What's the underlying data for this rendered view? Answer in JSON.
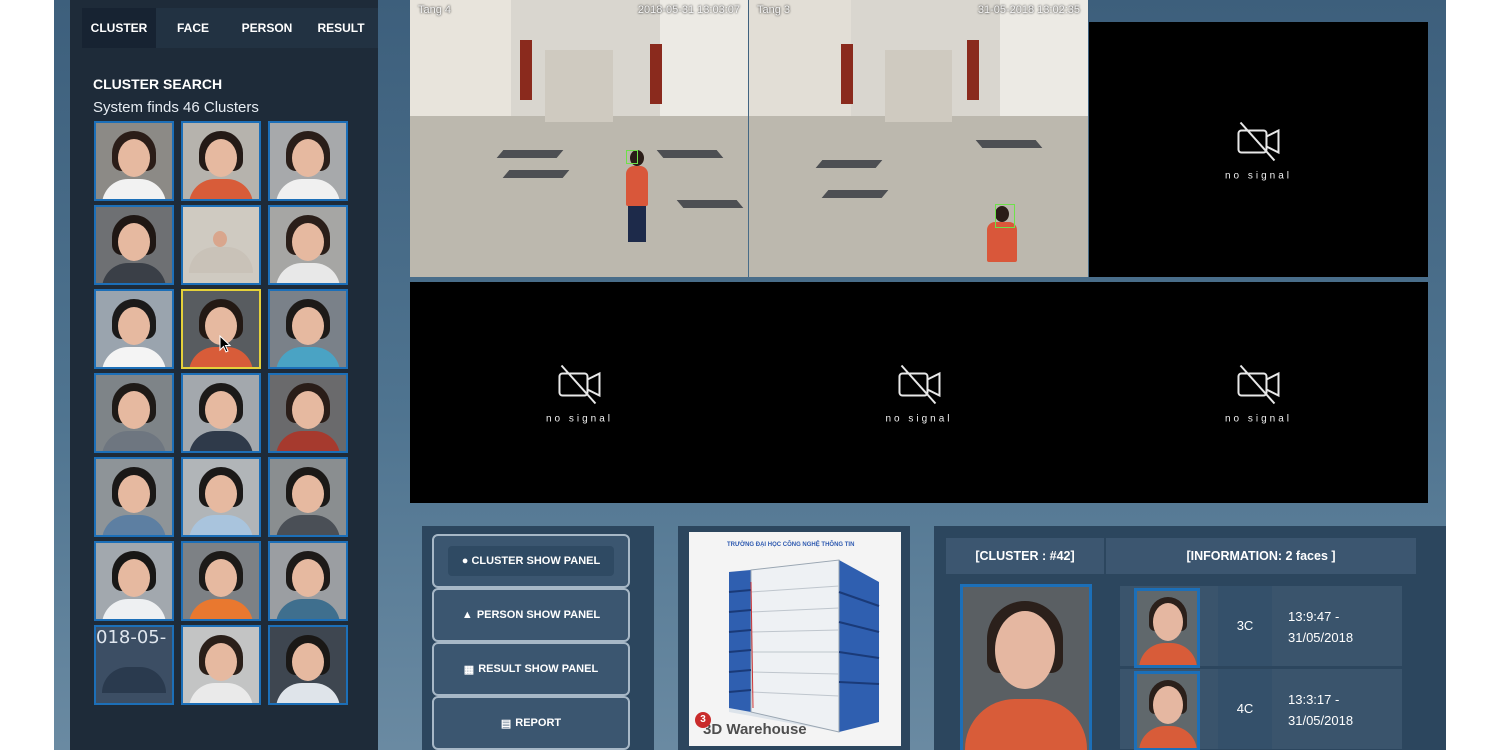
{
  "tabs": [
    {
      "label": "CLUSTER",
      "active": true
    },
    {
      "label": "FACE",
      "active": false
    },
    {
      "label": "PERSON",
      "active": false
    },
    {
      "label": "RESULT",
      "active": false
    }
  ],
  "cluster_search": {
    "title": "CLUSTER SEARCH",
    "count_text": "System finds 46 Clusters",
    "selected_index": 7,
    "thumbnail_overlay_text": "018-05-"
  },
  "cameras": [
    {
      "label": "Tang 4",
      "timestamp": "2018-05-31 13:03:07",
      "signal": true
    },
    {
      "label": "Tang 3",
      "timestamp": "31-05-2018 13:02:35",
      "signal": true
    },
    {
      "label": "",
      "timestamp": "",
      "signal": false,
      "no_signal_text": "no signal"
    },
    {
      "label": "",
      "timestamp": "",
      "signal": false,
      "no_signal_text": "no signal"
    },
    {
      "label": "",
      "timestamp": "",
      "signal": false,
      "no_signal_text": "no signal"
    },
    {
      "label": "",
      "timestamp": "",
      "signal": false,
      "no_signal_text": "no signal"
    }
  ],
  "controls": {
    "cluster_show": "CLUSTER SHOW PANEL",
    "person_show": "PERSON SHOW PANEL",
    "result_show": "RESULT SHOW PANEL",
    "report": "REPORT"
  },
  "building": {
    "sign_text": "TRƯỜNG ĐẠI HỌC CÔNG NGHỆ THÔNG TIN",
    "watermark": "3D Warehouse"
  },
  "info": {
    "cluster_header": "[CLUSTER : #42]",
    "info_header": "[INFORMATION: 2 faces ]",
    "rows": [
      {
        "camera": "3C",
        "time": "13:9:47 -",
        "date": "31/05/2018"
      },
      {
        "camera": "4C",
        "time": "13:3:17 -",
        "date": "31/05/2018"
      }
    ]
  },
  "colors": {
    "accent_blue": "#1c6fb8",
    "selected_yellow": "#e5d13a",
    "detect_green": "#6ee14a",
    "panel_dark": "#1e2b39"
  }
}
